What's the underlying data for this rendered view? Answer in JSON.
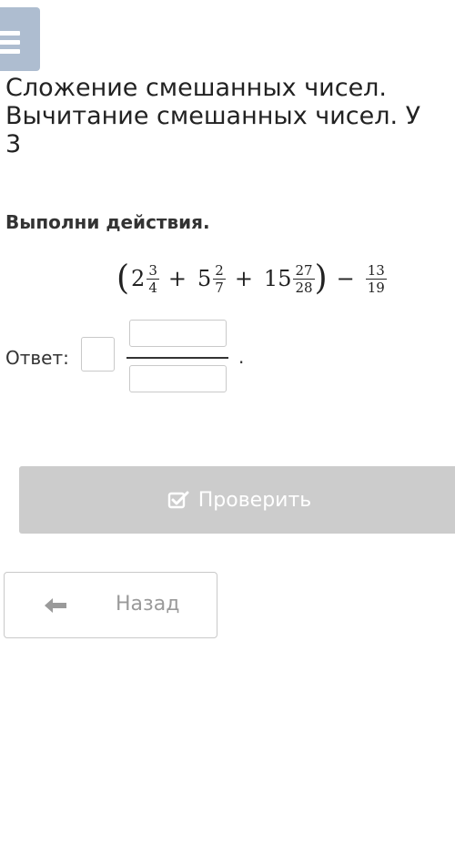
{
  "header": {
    "menu_icon": "hamburger-menu-icon",
    "title_line1": "Сложение смешанных чисел.",
    "title_line2": "Вычитание смешанных чисел. У",
    "title_line3": "3"
  },
  "task": {
    "instruction": "Выполни действия.",
    "expression": {
      "open_paren": "(",
      "term1_whole": "2",
      "term1_num": "3",
      "term1_den": "4",
      "op1": "+",
      "term2_whole": "5",
      "term2_num": "2",
      "term2_den": "7",
      "op2": "+",
      "term3_whole": "15",
      "term3_num": "27",
      "term3_den": "28",
      "close_paren": ")",
      "op3": "−",
      "term4_num": "13",
      "term4_den": "19"
    }
  },
  "answer": {
    "label": "Ответ:",
    "whole_value": "",
    "numerator_value": "",
    "denominator_value": "",
    "period": "."
  },
  "buttons": {
    "check_label": "Проверить",
    "check_icon": "checkbox-edit-icon",
    "back_label": "Назад",
    "back_icon": "arrow-left-icon"
  },
  "colors": {
    "menu_bg": "#aebdd0",
    "check_bg": "#cccccc",
    "back_text": "#9a9a9a"
  }
}
